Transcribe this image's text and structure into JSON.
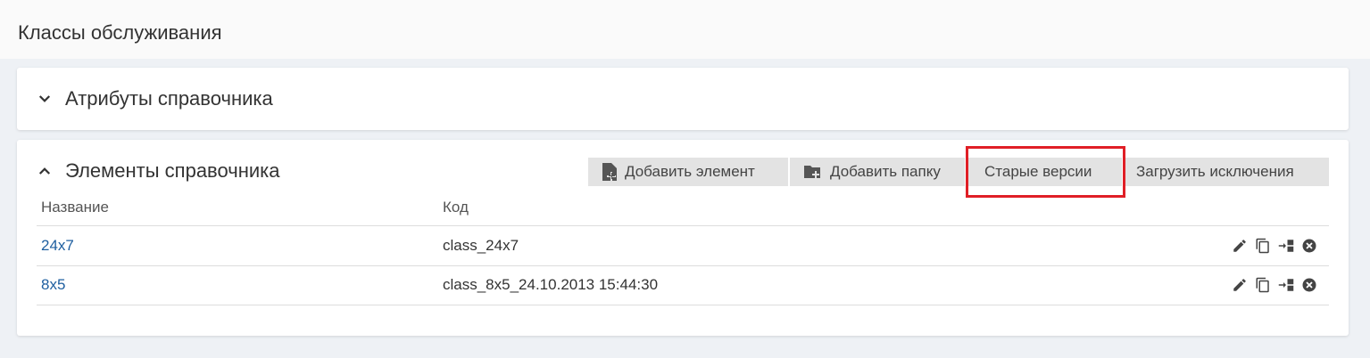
{
  "page": {
    "title": "Классы обслуживания"
  },
  "attributes_section": {
    "title": "Атрибуты справочника",
    "expanded": false
  },
  "elements_section": {
    "title": "Элементы справочника",
    "expanded": true,
    "toolbar": {
      "add_element": "Добавить элемент",
      "add_folder": "Добавить папку",
      "old_versions": "Старые версии",
      "load_exceptions": "Загрузить исключения"
    },
    "columns": {
      "name": "Название",
      "code": "Код"
    },
    "rows": [
      {
        "name": "24x7",
        "code": "class_24x7"
      },
      {
        "name": "8x5",
        "code": "class_8x5_24.10.2013 15:44:30"
      }
    ],
    "row_actions": [
      "edit-icon",
      "copy-icon",
      "move-icon",
      "delete-icon"
    ]
  },
  "colors": {
    "link": "#1f5fa0",
    "highlight": "#e01f26",
    "button_bg": "#e3e3e3",
    "page_bg": "#eef1f5"
  }
}
